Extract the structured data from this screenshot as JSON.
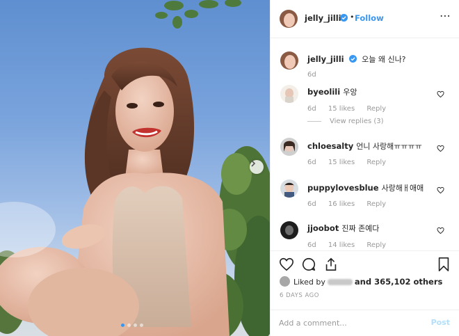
{
  "post": {
    "username": "jelly_jilli",
    "follow_label": "Follow",
    "separator": "•",
    "more_icon": "more-options-icon",
    "photo": {
      "subject": "woman-in-knit-crop-top-outdoors",
      "carousel_dots": 4,
      "active_dot": 0
    },
    "caption": {
      "username": "jelly_jilli",
      "text": "오늘 왜 신나?",
      "age": "6d"
    },
    "comments": [
      {
        "username": "byeolili",
        "text": "우앙",
        "age": "6d",
        "likes": "15 likes",
        "reply": "Reply",
        "view_replies": "View replies (3)"
      },
      {
        "username": "chloesalty",
        "text": "언니 사랑해ㅠㅠㅠㅠ",
        "age": "6d",
        "likes": "15 likes",
        "reply": "Reply"
      },
      {
        "username": "puppylovesblue",
        "text": "사랑해ㅐ애애",
        "age": "6d",
        "likes": "16 likes",
        "reply": "Reply"
      },
      {
        "username": "jjoobot",
        "text": "진짜 존예다",
        "age": "6d",
        "likes": "14 likes",
        "reply": "Reply"
      }
    ],
    "liked_by_prefix": "Liked by",
    "liked_by_and": "and 365,102 others",
    "timestamp": "6 DAYS AGO",
    "add_comment_placeholder": "Add a comment...",
    "post_label": "Post",
    "colors": {
      "link_blue": "#3897f0",
      "post_disabled": "#b2dffc",
      "muted": "#999999"
    }
  }
}
